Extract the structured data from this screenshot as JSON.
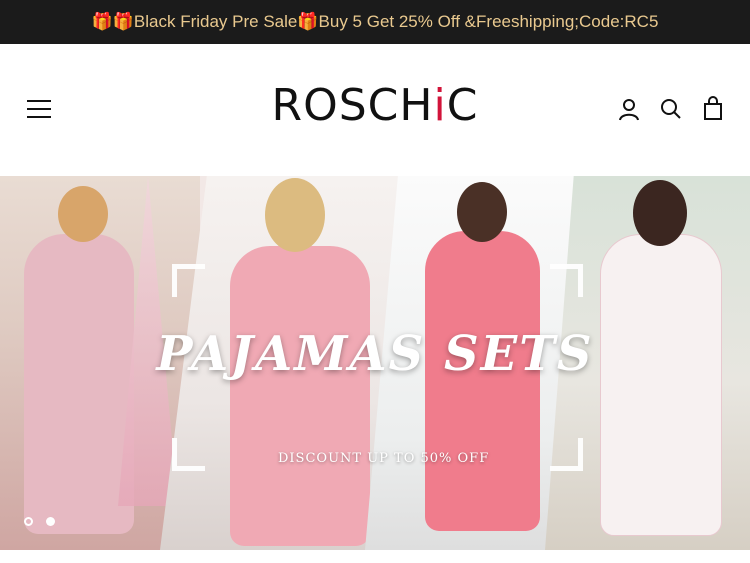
{
  "announcement": {
    "text": "🎁🎁Black Friday Pre Sale🎁Buy 5 Get 25% Off &Freeshipping;Code:RC5"
  },
  "header": {
    "logo_main": "ROSCH",
    "logo_accent": "i",
    "logo_end": "C",
    "icons": [
      "menu-icon",
      "account-icon",
      "search-icon",
      "cart-bag-icon"
    ]
  },
  "hero": {
    "title": "PAJAMAS SETS",
    "subtitle": "DISCOUNT UP TO 50% OFF",
    "slide_count": 2,
    "active_slide": 2
  },
  "colors": {
    "announcement_bg": "#1b1b1b",
    "announcement_text": "#e9c98f",
    "logo_accent": "#d2143a"
  }
}
